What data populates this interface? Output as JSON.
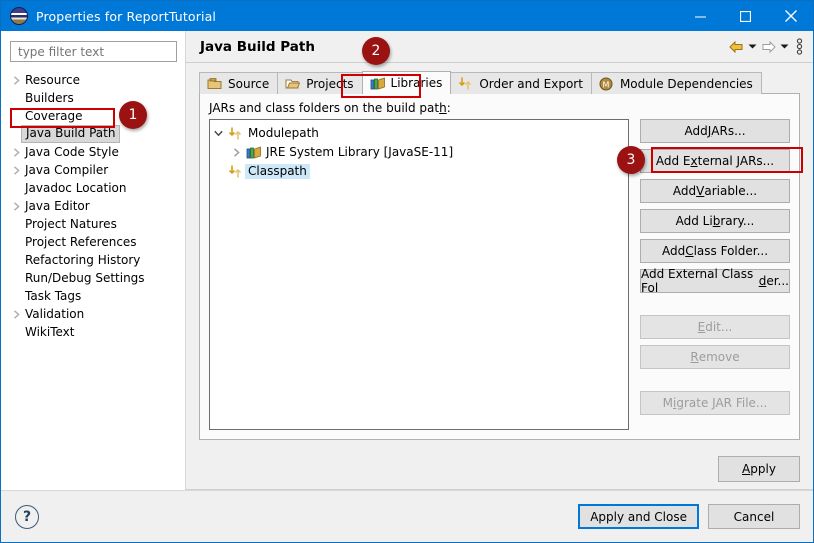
{
  "window": {
    "title": "Properties for ReportTutorial",
    "app_icon": "eclipse-icon",
    "minimize": "minimize-icon",
    "maximize": "maximize-icon",
    "close": "close-icon"
  },
  "sidebar": {
    "filter_placeholder": "type filter text",
    "filter_value": "",
    "items": [
      {
        "label": "Resource",
        "expandable": true,
        "selected": false
      },
      {
        "label": "Builders",
        "expandable": false,
        "selected": false
      },
      {
        "label": "Coverage",
        "expandable": false,
        "selected": false
      },
      {
        "label": "Java Build Path",
        "expandable": false,
        "selected": true
      },
      {
        "label": "Java Code Style",
        "expandable": true,
        "selected": false
      },
      {
        "label": "Java Compiler",
        "expandable": true,
        "selected": false
      },
      {
        "label": "Javadoc Location",
        "expandable": false,
        "selected": false
      },
      {
        "label": "Java Editor",
        "expandable": true,
        "selected": false
      },
      {
        "label": "Project Natures",
        "expandable": false,
        "selected": false
      },
      {
        "label": "Project References",
        "expandable": false,
        "selected": false
      },
      {
        "label": "Refactoring History",
        "expandable": false,
        "selected": false
      },
      {
        "label": "Run/Debug Settings",
        "expandable": false,
        "selected": false
      },
      {
        "label": "Task Tags",
        "expandable": false,
        "selected": false
      },
      {
        "label": "Validation",
        "expandable": true,
        "selected": false
      },
      {
        "label": "WikiText",
        "expandable": false,
        "selected": false
      }
    ]
  },
  "header": {
    "title": "Java Build Path",
    "back_icon": "back-arrow-icon",
    "back_dropdown_icon": "chevron-down-icon",
    "forward_icon": "forward-arrow-icon",
    "forward_dropdown_icon": "chevron-down-icon",
    "menu_icon": "vertical-dots-menu-icon"
  },
  "tabs": [
    {
      "label": "Source",
      "icon": "source-package-icon",
      "active": false
    },
    {
      "label": "Projects",
      "icon": "open-folder-icon",
      "active": false
    },
    {
      "label": "Libraries",
      "icon": "library-books-icon",
      "active": true
    },
    {
      "label": "Order and Export",
      "icon": "up-down-arrows-icon",
      "active": false
    },
    {
      "label": "Module Dependencies",
      "icon": "module-m-icon",
      "active": false
    }
  ],
  "panel": {
    "label_before": "JARs and class folders on the build pat",
    "label_mnemonic": "h",
    "label_after": ":",
    "tree": [
      {
        "label": "Modulepath",
        "icon": "up-down-arrows-icon",
        "indent": 0,
        "twisty": "expanded",
        "selected": false
      },
      {
        "label": "JRE System Library [JavaSE-11]",
        "icon": "library-books-icon",
        "indent": 1,
        "twisty": "collapsed",
        "selected": false
      },
      {
        "label": "Classpath",
        "icon": "up-down-arrows-icon",
        "indent": 0,
        "twisty": "none",
        "selected": true
      }
    ]
  },
  "buttons": [
    {
      "pre": "Add ",
      "mnemonic": "J",
      "post": "ARs...",
      "disabled": false,
      "name": "add-jars-button"
    },
    {
      "pre": "Add E",
      "mnemonic": "x",
      "post": "ternal JARs...",
      "disabled": false,
      "name": "add-external-jars-button"
    },
    {
      "pre": "Add ",
      "mnemonic": "V",
      "post": "ariable...",
      "disabled": false,
      "name": "add-variable-button"
    },
    {
      "pre": "Add Li",
      "mnemonic": "b",
      "post": "rary...",
      "disabled": false,
      "name": "add-library-button"
    },
    {
      "pre": "Add ",
      "mnemonic": "C",
      "post": "lass Folder...",
      "disabled": false,
      "name": "add-class-folder-button"
    },
    {
      "pre": "Add External Class Fol",
      "mnemonic": "d",
      "post": "er...",
      "disabled": false,
      "name": "add-external-class-folder-button"
    },
    {
      "gap": true
    },
    {
      "pre": "",
      "mnemonic": "E",
      "post": "dit...",
      "disabled": true,
      "name": "edit-button"
    },
    {
      "pre": "",
      "mnemonic": "R",
      "post": "emove",
      "disabled": true,
      "name": "remove-button"
    },
    {
      "gap": true
    },
    {
      "pre": "M",
      "mnemonic": "i",
      "post": "grate JAR File...",
      "disabled": true,
      "name": "migrate-jar-file-button"
    }
  ],
  "apply": {
    "pre": "",
    "mnemonic": "A",
    "post": "pply"
  },
  "footer": {
    "help_icon": "help-question-icon",
    "apply_and_close": "Apply and Close",
    "cancel": "Cancel"
  },
  "annotations": {
    "accent_color": "#cc0000",
    "badge_color": "#9b1212",
    "badges": [
      {
        "number": "1",
        "target": "sidebar-item-java-build-path"
      },
      {
        "number": "2",
        "target": "page-title"
      },
      {
        "number": "3",
        "target": "add-external-jars-button"
      }
    ]
  }
}
